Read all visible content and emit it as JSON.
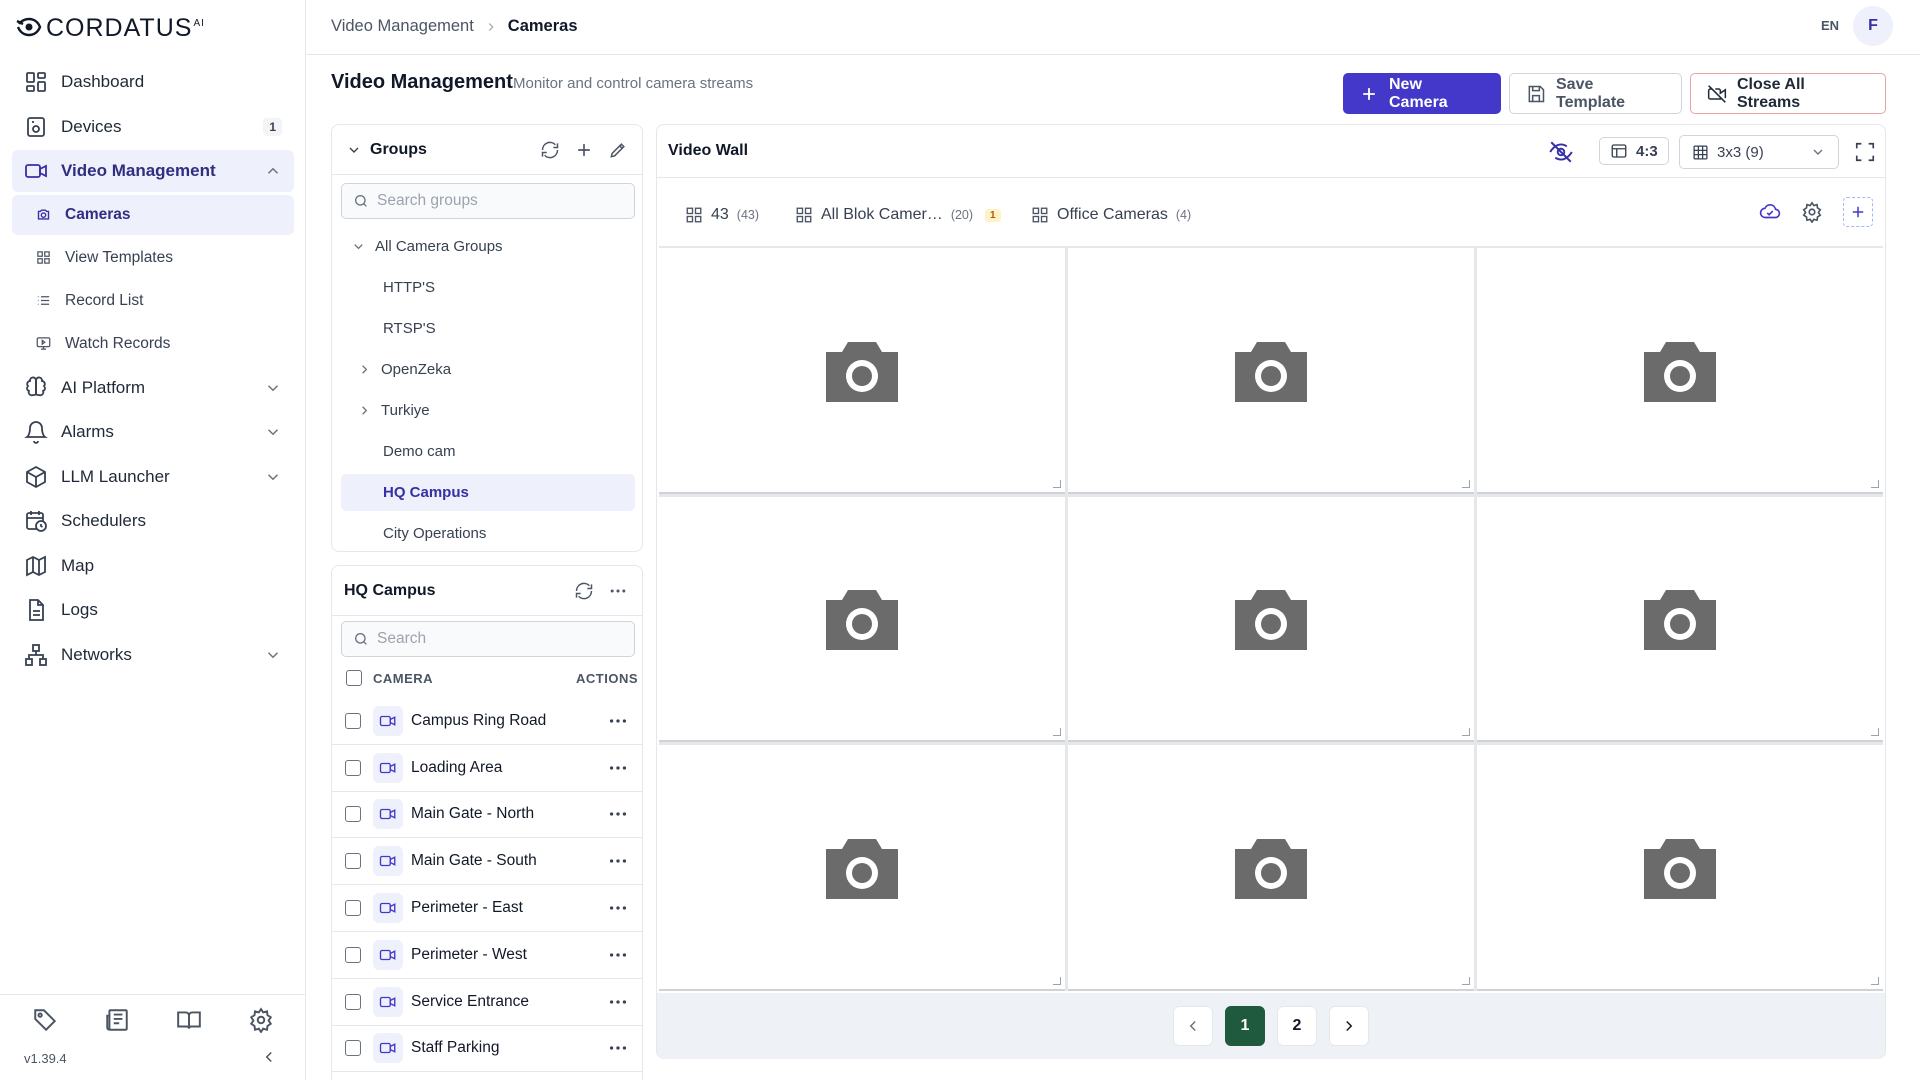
{
  "app": {
    "logo_text": "CORDATUS",
    "logo_sup": "AI",
    "version": "v1.39.4"
  },
  "sidebar": {
    "items": [
      {
        "label": "Dashboard",
        "icon": "dashboard-icon"
      },
      {
        "label": "Devices",
        "icon": "devices-icon",
        "badge": "1"
      },
      {
        "label": "Video Management",
        "icon": "video-icon",
        "expanded": true
      },
      {
        "label": "AI Platform",
        "icon": "brain-icon"
      },
      {
        "label": "Alarms",
        "icon": "bell-icon"
      },
      {
        "label": "LLM Launcher",
        "icon": "cube-icon"
      },
      {
        "label": "Schedulers",
        "icon": "calendar-clock-icon"
      },
      {
        "label": "Map",
        "icon": "map-icon"
      },
      {
        "label": "Logs",
        "icon": "document-icon"
      },
      {
        "label": "Networks",
        "icon": "network-icon"
      }
    ],
    "video_sub": [
      {
        "label": "Cameras",
        "icon": "camera-icon",
        "active": true
      },
      {
        "label": "View Templates",
        "icon": "grid-icon"
      },
      {
        "label": "Record List",
        "icon": "list-icon"
      },
      {
        "label": "Watch Records",
        "icon": "monitor-play-icon"
      }
    ],
    "bottom_icons": [
      "tag-icon",
      "newspaper-icon",
      "book-icon",
      "settings-icon"
    ]
  },
  "topbar": {
    "breadcrumb": [
      "Video Management",
      "Cameras"
    ],
    "lang": "EN",
    "avatar": "F"
  },
  "page": {
    "title": "Video Management",
    "subtitle": "Monitor and control camera streams",
    "new_camera": "New Camera",
    "save_template": "Save Template",
    "close_all": "Close All Streams"
  },
  "groups": {
    "title": "Groups",
    "search_placeholder": "Search groups",
    "root": "All Camera Groups",
    "items": [
      {
        "label": "HTTP'S",
        "expandable": false
      },
      {
        "label": "RTSP'S",
        "expandable": false
      },
      {
        "label": "OpenZeka",
        "expandable": true
      },
      {
        "label": "Turkiye",
        "expandable": true
      },
      {
        "label": "Demo cam",
        "expandable": false
      },
      {
        "label": "HQ Campus",
        "expandable": false,
        "active": true
      },
      {
        "label": "City Operations",
        "expandable": false
      }
    ]
  },
  "camlist": {
    "title": "HQ Campus",
    "search_placeholder": "Search",
    "col_camera": "CAMERA",
    "col_actions": "ACTIONS",
    "rows": [
      "Campus Ring Road",
      "Loading Area",
      "Main Gate - North",
      "Main Gate - South",
      "Perimeter - East",
      "Perimeter - West",
      "Service Entrance",
      "Staff Parking"
    ]
  },
  "wall": {
    "title": "Video Wall",
    "ratio": "4:3",
    "layout": "3x3 (9)",
    "tabs": [
      {
        "label": "43",
        "count": "(43)"
      },
      {
        "label": "All Blok Camer…",
        "count": "(20)",
        "badge": "1"
      },
      {
        "label": "Office Cameras",
        "count": "(4)"
      }
    ],
    "pages": [
      "1",
      "2"
    ],
    "current_page": "1"
  },
  "colors": {
    "primary": "#4338ca",
    "active_bg": "#eef0fb",
    "page_active": "#1f5a3f",
    "placeholder_icon": "#6b6b6b"
  }
}
